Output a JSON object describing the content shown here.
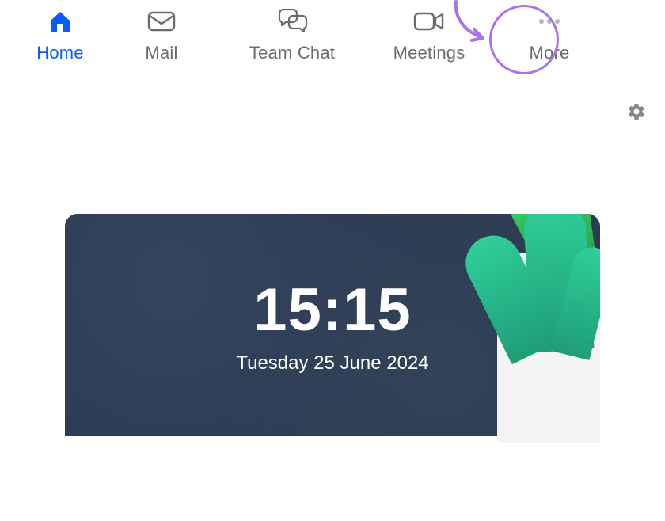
{
  "tabs": {
    "home": {
      "label": "Home",
      "active": true
    },
    "mail": {
      "label": "Mail",
      "active": false
    },
    "teamchat": {
      "label": "Team Chat",
      "active": false
    },
    "meetings": {
      "label": "Meetings",
      "active": false
    },
    "more": {
      "label": "More",
      "active": false
    }
  },
  "annotation": {
    "color": "#a973ef"
  },
  "clock": {
    "time": "15:15",
    "date": "Tuesday 25 June 2024"
  },
  "colors": {
    "active_blue": "#0b5cff",
    "inactive_gray": "#6b6b6b",
    "card_bg": "#2b3a52"
  }
}
